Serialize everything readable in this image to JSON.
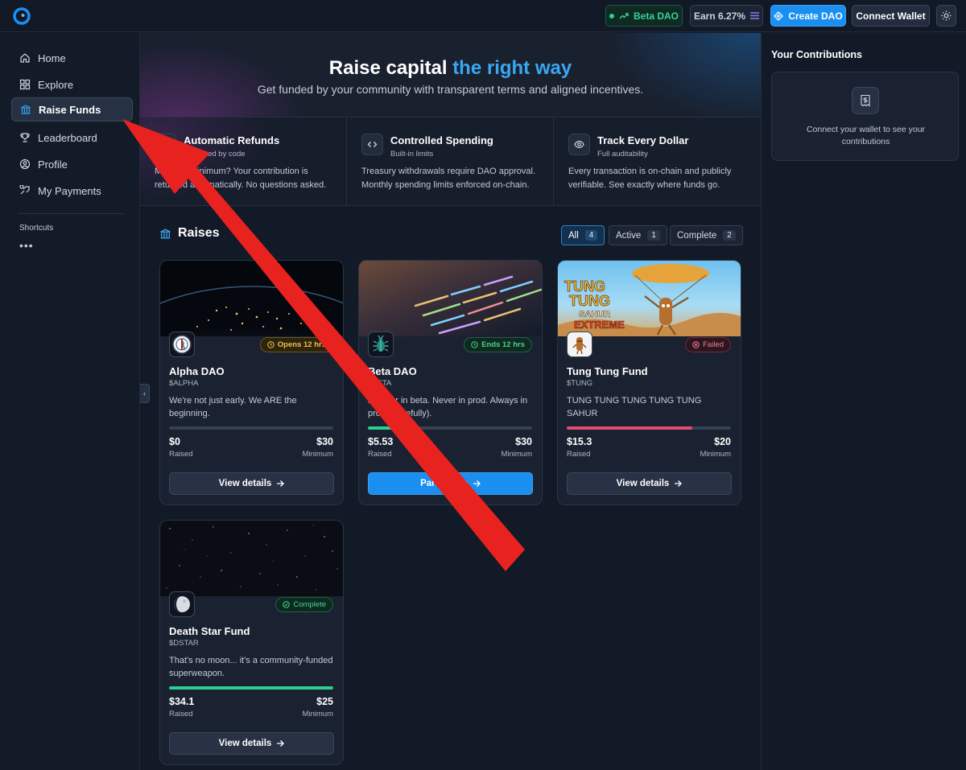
{
  "topbar": {
    "beta_label": "Beta DAO",
    "earn_label": "Earn 6.27%",
    "create_label": "Create DAO",
    "connect_label": "Connect Wallet"
  },
  "sidebar": {
    "items": [
      {
        "label": "Home",
        "icon": "home-icon"
      },
      {
        "label": "Explore",
        "icon": "grid-icon"
      },
      {
        "label": "Raise Funds",
        "icon": "bank-icon",
        "active": true
      },
      {
        "label": "Leaderboard",
        "icon": "trophy-icon"
      },
      {
        "label": "Profile",
        "icon": "user-icon"
      },
      {
        "label": "My Payments",
        "icon": "payments-icon"
      }
    ],
    "shortcuts_label": "Shortcuts",
    "more": "•••"
  },
  "hero": {
    "title_main": "Raise capital ",
    "title_accent": "the right way",
    "subtitle": "Get funded by your community with transparent terms and aligned incentives."
  },
  "features": [
    {
      "title": "Automatic Refunds",
      "subtitle": "Protected by code",
      "desc": "Miss the minimum? Your contribution is returned automatically. No questions asked."
    },
    {
      "title": "Controlled Spending",
      "subtitle": "Built-in limits",
      "desc": "Treasury withdrawals require DAO approval. Monthly spending limits enforced on-chain."
    },
    {
      "title": "Track Every Dollar",
      "subtitle": "Full auditability",
      "desc": "Every transaction is on-chain and publicly verifiable. See exactly where funds go."
    }
  ],
  "raises": {
    "title": "Raises",
    "filters": [
      {
        "label": "All",
        "count": "4",
        "active": true
      },
      {
        "label": "Active",
        "count": "1"
      },
      {
        "label": "Complete",
        "count": "2"
      }
    ]
  },
  "cards": [
    {
      "name": "Alpha DAO",
      "ticker": "$ALPHA",
      "badge": "Opens 12 hrs",
      "desc": "We're not just early. We ARE the beginning.",
      "raised": "$0",
      "raised_label": "Raised",
      "minimum": "$30",
      "minimum_label": "Minimum",
      "progress": 0.0,
      "button": "View details"
    },
    {
      "name": "Beta DAO",
      "ticker": "$BETA",
      "badge": "Ends 12 hrs",
      "desc": "Forever in beta. Never in prod. Always in prod (hopefully).",
      "raised": "$5.53",
      "raised_label": "Raised",
      "minimum": "$30",
      "minimum_label": "Minimum",
      "progress": 0.18,
      "button": "Participate"
    },
    {
      "name": "Tung Tung Fund",
      "ticker": "$TUNG",
      "badge": "Failed",
      "desc": "TUNG TUNG TUNG TUNG TUNG SAHUR",
      "raised": "$15.3",
      "raised_label": "Raised",
      "minimum": "$20",
      "minimum_label": "Minimum",
      "progress": 0.765,
      "button": "View details"
    },
    {
      "name": "Death Star Fund",
      "ticker": "$DSTAR",
      "badge": "Complete",
      "desc": "That's no moon... it's a community-funded superweapon.",
      "raised": "$34.1",
      "raised_label": "Raised",
      "minimum": "$25",
      "minimum_label": "Minimum",
      "progress": 1.0,
      "button": "View details"
    }
  ],
  "contributions": {
    "title": "Your Contributions",
    "message": "Connect your wallet to see your contributions"
  },
  "colors": {
    "accent": "#1a8ff0",
    "success": "#2bd08c",
    "danger": "#e0506d",
    "annotation_arrow": "#e8221f"
  }
}
